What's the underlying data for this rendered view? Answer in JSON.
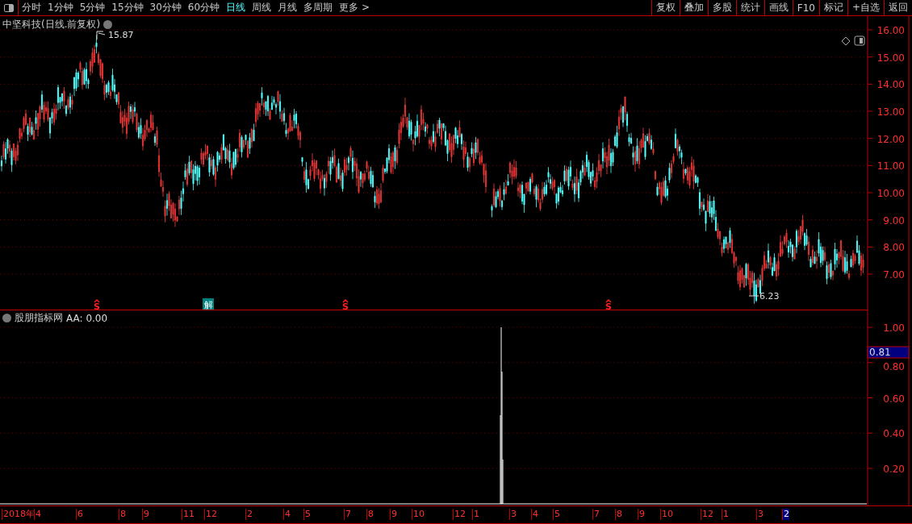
{
  "toolbar": {
    "periods": [
      {
        "label": "分时",
        "selected": false
      },
      {
        "label": "1分钟",
        "selected": false
      },
      {
        "label": "5分钟",
        "selected": false
      },
      {
        "label": "15分钟",
        "selected": false
      },
      {
        "label": "30分钟",
        "selected": false
      },
      {
        "label": "60分钟",
        "selected": false
      },
      {
        "label": "日线",
        "selected": true
      },
      {
        "label": "周线",
        "selected": false
      },
      {
        "label": "月线",
        "selected": false
      },
      {
        "label": "多周期",
        "selected": false
      },
      {
        "label": "更多 >",
        "selected": false
      }
    ],
    "actions": [
      "复权",
      "叠加",
      "多股",
      "统计",
      "画线",
      "F10",
      "标记",
      "+自选",
      "返回"
    ]
  },
  "main_chart": {
    "title": "中坚科技(日线.前复权)",
    "high_label": "15.87",
    "low_label": "6.23",
    "y_labels": [
      "16.00",
      "15.00",
      "14.00",
      "13.00",
      "12.00",
      "11.00",
      "10.00",
      "9.00",
      "8.00",
      "7.00"
    ],
    "markers": [
      {
        "kind": "sell",
        "label": "S"
      },
      {
        "kind": "unlock",
        "label": "解"
      },
      {
        "kind": "sell",
        "label": "S"
      },
      {
        "kind": "sell",
        "label": "S"
      }
    ]
  },
  "indicator": {
    "title": "股朋指标网",
    "reading": "AA: 0.00",
    "y_labels": [
      "1.00",
      "0.80",
      "0.60",
      "0.40",
      "0.20"
    ],
    "cursor_value": "0.81"
  },
  "time_axis": {
    "labels": [
      {
        "label": "2018年",
        "selected": false
      },
      {
        "label": "4",
        "selected": false
      },
      {
        "label": "6",
        "selected": false
      },
      {
        "label": "8",
        "selected": false
      },
      {
        "label": "9",
        "selected": false
      },
      {
        "label": "11",
        "selected": false
      },
      {
        "label": "12",
        "selected": false
      },
      {
        "label": "2",
        "selected": false
      },
      {
        "label": "4",
        "selected": false
      },
      {
        "label": "5",
        "selected": false
      },
      {
        "label": "7",
        "selected": false
      },
      {
        "label": "8",
        "selected": false
      },
      {
        "label": "9",
        "selected": false
      },
      {
        "label": "10",
        "selected": false
      },
      {
        "label": "12",
        "selected": false
      },
      {
        "label": "1",
        "selected": false
      },
      {
        "label": "3",
        "selected": false
      },
      {
        "label": "4",
        "selected": false
      },
      {
        "label": "5",
        "selected": false
      },
      {
        "label": "7",
        "selected": false
      },
      {
        "label": "8",
        "selected": false
      },
      {
        "label": "9",
        "selected": false
      },
      {
        "label": "10",
        "selected": false
      },
      {
        "label": "12",
        "selected": false
      },
      {
        "label": "1",
        "selected": false
      },
      {
        "label": "3",
        "selected": false
      },
      {
        "label": "2",
        "selected": true
      }
    ]
  }
}
